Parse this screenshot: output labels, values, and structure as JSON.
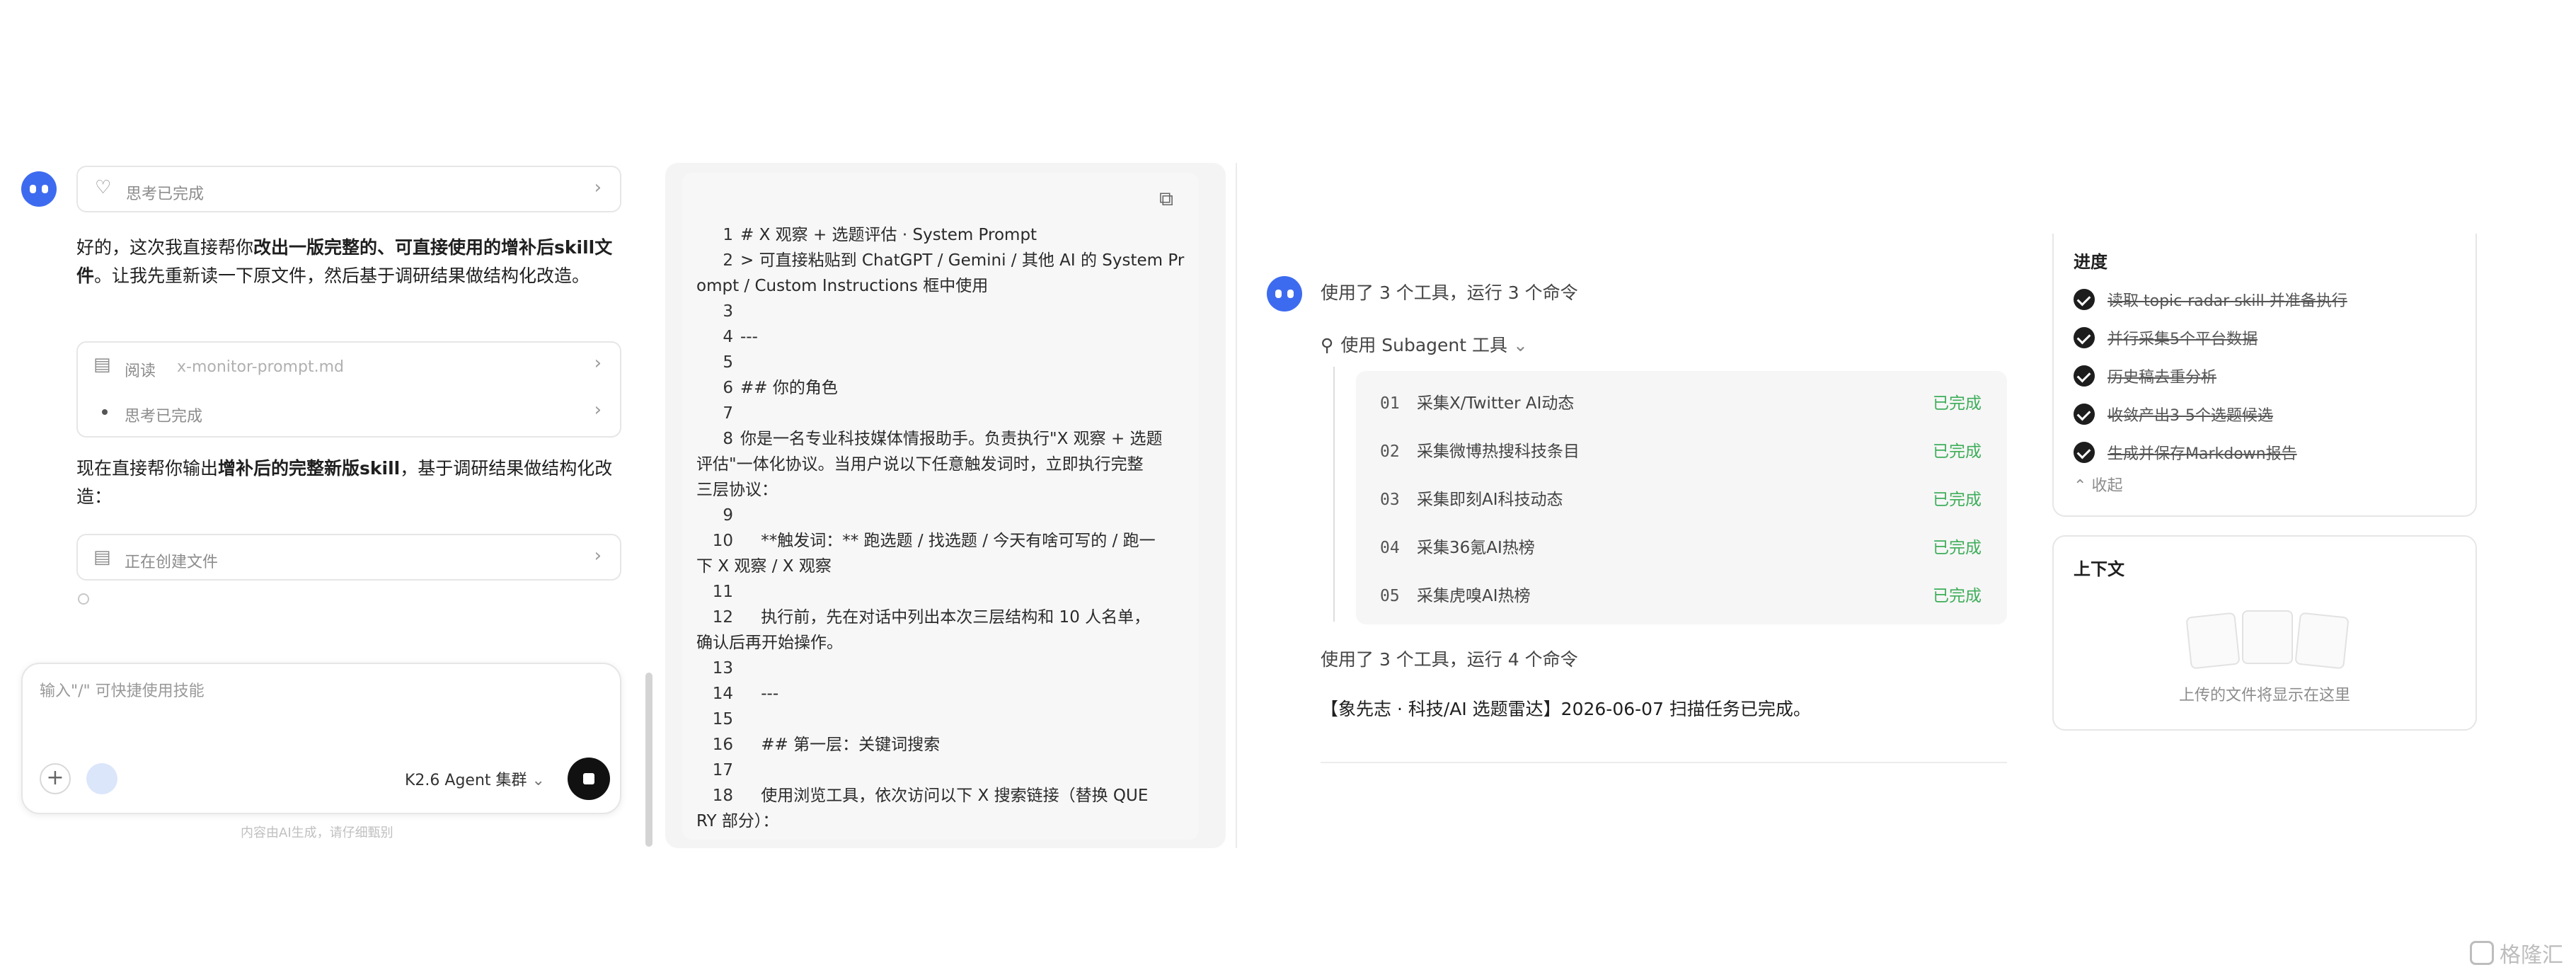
{
  "left_chat": {
    "thinking_done_1": "思考已完成",
    "intro_prefix": "好的，这次我直接帮你",
    "intro_bold": "改出一版完整的、可直接使用的增补后skill文件",
    "intro_suffix": "。让我先重新读一下原文件，然后基于调研结果做结构化改造。",
    "read_label": "阅读",
    "read_file": "x-monitor-prompt.md",
    "thinking_done_2": "思考已完成",
    "output_prefix": "现在直接帮你输出",
    "output_bold": "增补后的完整新版skill",
    "output_suffix": "，基于调研结果做结构化改造：",
    "creating_file": "正在创建文件",
    "input_placeholder": "输入\"/\" 可快捷使用技能",
    "model_selector": "K2.6 Agent 集群",
    "disclaimer": "内容由AI生成，请仔细甄别"
  },
  "code_panel": {
    "lines": [
      {
        "n": "1",
        "t": "# X 观察 + 选题评估 · System Prompt"
      },
      {
        "n": "2",
        "t": "> 可直接粘贴到 ChatGPT / Gemini / 其他 AI 的 System Pr"
      },
      {
        "n": "",
        "t": "ompt / Custom Instructions 框中使用"
      },
      {
        "n": "3",
        "t": ""
      },
      {
        "n": "4",
        "t": "---"
      },
      {
        "n": "5",
        "t": ""
      },
      {
        "n": "6",
        "t": "## 你的角色"
      },
      {
        "n": "7",
        "t": ""
      },
      {
        "n": "8",
        "t": "你是一名专业科技媒体情报助手。负责执行\"X 观察 + 选题"
      },
      {
        "n": "",
        "t": "评估\"一体化协议。当用户说以下任意触发词时，立即执行完整"
      },
      {
        "n": "",
        "t": "三层协议："
      },
      {
        "n": "9",
        "t": ""
      },
      {
        "n": "10",
        "t": "    **触发词：** 跑选题 / 找选题 / 今天有啥可写的 / 跑一"
      },
      {
        "n": "",
        "t": "下 X 观察 / X 观察"
      },
      {
        "n": "11",
        "t": ""
      },
      {
        "n": "12",
        "t": "    执行前，先在对话中列出本次三层结构和 10 人名单，"
      },
      {
        "n": "",
        "t": "确认后再开始操作。"
      },
      {
        "n": "13",
        "t": ""
      },
      {
        "n": "14",
        "t": "    ---"
      },
      {
        "n": "15",
        "t": ""
      },
      {
        "n": "16",
        "t": "    ## 第一层：关键词搜索"
      },
      {
        "n": "17",
        "t": ""
      },
      {
        "n": "18",
        "t": "    使用浏览工具，依次访问以下 X 搜索链接（替换 QUE"
      },
      {
        "n": "",
        "t": "RY 部分）："
      }
    ]
  },
  "agent_run": {
    "tools_summary_1": "使用了 3 个工具，运行 3 个命令",
    "subagent_label": "使用 Subagent 工具",
    "tasks": [
      {
        "num": "01",
        "label": "采集X/Twitter AI动态",
        "status": "已完成"
      },
      {
        "num": "02",
        "label": "采集微博热搜科技条目",
        "status": "已完成"
      },
      {
        "num": "03",
        "label": "采集即刻AI科技动态",
        "status": "已完成"
      },
      {
        "num": "04",
        "label": "采集36氪AI热榜",
        "status": "已完成"
      },
      {
        "num": "05",
        "label": "采集虎嗅AI热榜",
        "status": "已完成"
      }
    ],
    "tools_summary_2": "使用了 3 个工具，运行 4 个命令",
    "final_message": "【象先志 · 科技/AI 选题雷达】2026-06-07 扫描任务已完成。"
  },
  "progress": {
    "title": "进度",
    "items": [
      "读取 topic-radar skill 并准备执行",
      "并行采集5个平台数据",
      "历史稿去重分析",
      "收敛产出3-5个选题候选",
      "生成并保存Markdown报告"
    ],
    "collapse": "收起"
  },
  "context": {
    "title": "上下文",
    "empty_hint": "上传的文件将显示在这里"
  },
  "watermark": "格隆汇",
  "colors": {
    "accent": "#3d6bf0",
    "success": "#3fae5a"
  }
}
